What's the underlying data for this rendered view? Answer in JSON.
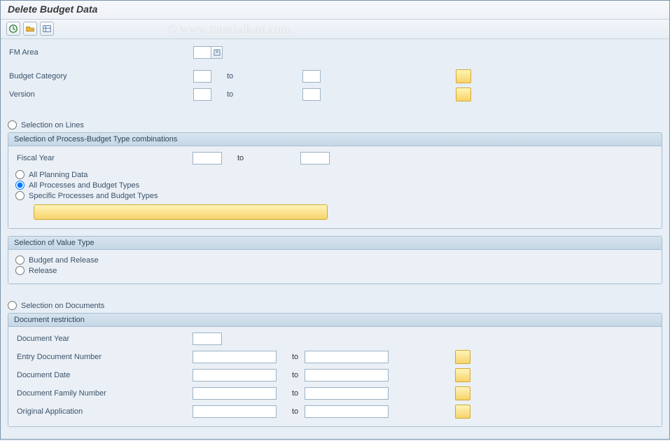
{
  "title": "Delete Budget Data",
  "watermark": "© www.tutorialkart.com",
  "toolbar": {
    "execute": "Execute",
    "get_variant": "Get Variant",
    "save_variant": "Save as Variant"
  },
  "top": {
    "fm_area_label": "FM Area",
    "fm_area_value": "",
    "budget_category_label": "Budget Category",
    "budget_category_from": "",
    "budget_category_to": "",
    "version_label": "Version",
    "version_from": "",
    "version_to": "",
    "to_label": "to"
  },
  "sel_lines": {
    "radio_label": "Selection on Lines",
    "group_title": "Selection of Process-Budget Type combinations",
    "fiscal_year_label": "Fiscal Year",
    "fiscal_year_from": "",
    "fiscal_year_to": "",
    "opt_all_planning": "All Planning Data",
    "opt_all_proc": "All Processes and Budget Types",
    "opt_specific": "Specific Processes and Budget Types",
    "btn_specific": ""
  },
  "sel_valtype": {
    "group_title": "Selection of Value Type",
    "opt_budget_release": "Budget and Release",
    "opt_release": "Release"
  },
  "sel_docs": {
    "radio_label": "Selection on Documents",
    "group_title": "Document restriction",
    "doc_year_label": "Document Year",
    "doc_year": "",
    "entry_docnum_label": "Entry Document Number",
    "entry_docnum_from": "",
    "entry_docnum_to": "",
    "doc_date_label": "Document Date",
    "doc_date_from": "",
    "doc_date_to": "",
    "doc_family_label": "Document Family Number",
    "doc_family_from": "",
    "doc_family_to": "",
    "orig_app_label": "Original Application",
    "orig_app_from": "",
    "orig_app_to": "",
    "to_label": "to"
  }
}
